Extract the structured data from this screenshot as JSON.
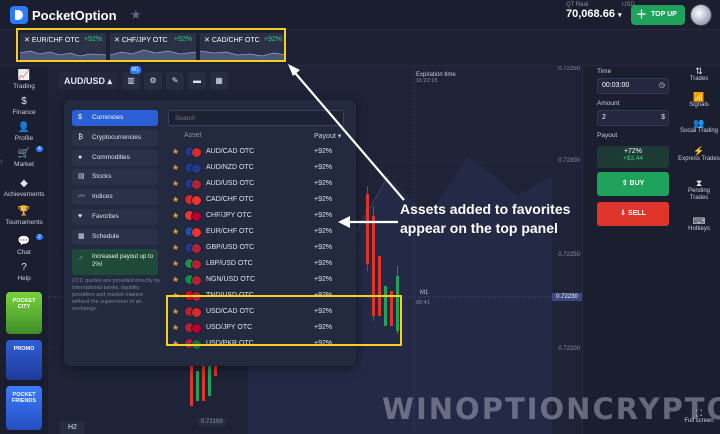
{
  "topbar": {
    "logo_text": "PocketOption",
    "account_type": "QT Real",
    "balance": "70,068.66",
    "currency": "USD",
    "top_up_label": "TOP UP"
  },
  "favorites": [
    {
      "name": "EUR/CHF OTC",
      "payout": "+92%"
    },
    {
      "name": "CHF/JPY OTC",
      "payout": "+92%"
    },
    {
      "name": "CAD/CHF OTC",
      "payout": "+92%"
    }
  ],
  "left_nav": [
    {
      "label": "Trading",
      "icon": "chart-icon"
    },
    {
      "label": "Finance",
      "icon": "dollar-icon"
    },
    {
      "label": "Profile",
      "icon": "user-icon"
    },
    {
      "label": "Market",
      "icon": "cart-icon",
      "badge": "4"
    },
    {
      "label": "Achievements",
      "icon": "diamond-icon"
    },
    {
      "label": "Tournaments",
      "icon": "trophy-icon"
    },
    {
      "label": "Chat",
      "icon": "chat-icon",
      "badge": "2"
    },
    {
      "label": "Help",
      "icon": "help-icon"
    }
  ],
  "promos": [
    {
      "label": "POCKET CITY"
    },
    {
      "label": "PROMO"
    },
    {
      "label": "POCKET FRIENDS"
    }
  ],
  "toolbar": {
    "pair": "AUD/USD",
    "timeframe_badge": "M1"
  },
  "asset_panel": {
    "search_placeholder": "Search",
    "col_asset": "Asset",
    "col_payout": "Payout",
    "categories": [
      {
        "label": "Currencies",
        "active": true
      },
      {
        "label": "Cryptocurrencies"
      },
      {
        "label": "Commodities"
      },
      {
        "label": "Stocks"
      },
      {
        "label": "Indices"
      },
      {
        "label": "Favorites"
      },
      {
        "label": "Schedule"
      }
    ],
    "promo_text": "Increased payout up to 2%!",
    "otc_note": "OTC quotes are provided directly by international banks, liquidity providers and market makers without the supervision of an exchange.",
    "assets": [
      {
        "name": "AUD/CAD OTC",
        "payout": "+92%",
        "fav": false
      },
      {
        "name": "AUD/NZD OTC",
        "payout": "+92%",
        "fav": false
      },
      {
        "name": "AUD/USD OTC",
        "payout": "+92%",
        "fav": false
      },
      {
        "name": "CAD/CHF OTC",
        "payout": "+92%",
        "fav": true
      },
      {
        "name": "CHF/JPY OTC",
        "payout": "+92%",
        "fav": true
      },
      {
        "name": "EUR/CHF OTC",
        "payout": "+92%",
        "fav": true
      },
      {
        "name": "GBP/USD OTC",
        "payout": "+92%",
        "fav": false
      },
      {
        "name": "LBP/USD OTC",
        "payout": "+92%",
        "fav": false
      },
      {
        "name": "NGN/USD OTC",
        "payout": "+92%",
        "fav": false
      },
      {
        "name": "TND/USD OTC",
        "payout": "+92%",
        "fav": false
      },
      {
        "name": "USD/CAD OTC",
        "payout": "+92%",
        "fav": false
      },
      {
        "name": "USD/JPY OTC",
        "payout": "+92%",
        "fav": false
      },
      {
        "name": "USD/PKR OTC",
        "payout": "+92%",
        "fav": false
      }
    ]
  },
  "chart": {
    "price_labels": [
      "0.72350",
      "0.72300",
      "0.72250",
      "0.72200"
    ],
    "current_price": "0.72230",
    "expiration_label": "Expiration time",
    "expiration_time": "16:22:15",
    "m1_label": "M1",
    "m1_time": "00:41",
    "bottom_price": "0.72169",
    "timeframe": "H2"
  },
  "trade_panel": {
    "time_label": "Time",
    "time_value": "00:03:00",
    "amount_label": "Amount",
    "amount_value": "2",
    "payout_label": "Payout",
    "payout_pct": "+72%",
    "payout_amount": "+$3.44",
    "buy_label": "BUY",
    "sell_label": "SELL"
  },
  "right_nav": [
    {
      "label": "Trades",
      "icon": "trades-icon"
    },
    {
      "label": "Signals",
      "icon": "signals-icon"
    },
    {
      "label": "Social Trading",
      "icon": "social-icon"
    },
    {
      "label": "Express Trades",
      "icon": "express-icon"
    },
    {
      "label": "Pending Trades",
      "icon": "pending-icon"
    },
    {
      "label": "Hotkeys",
      "icon": "keyboard-icon"
    },
    {
      "label": "Full screen",
      "icon": "fullscreen-icon"
    }
  ],
  "annotation": {
    "line1": "Assets added to favorites",
    "line2": "appear on the top panel",
    "highlight_color": "#f5d020"
  },
  "watermark": "WINOPTIONCRYPTO.COM"
}
